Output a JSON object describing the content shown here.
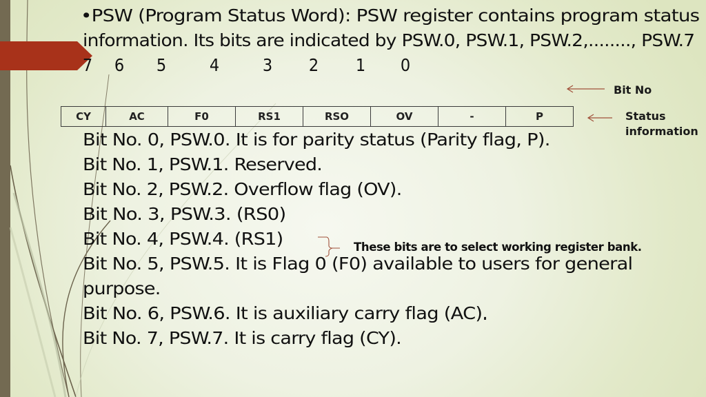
{
  "slide": {
    "heading_lines": [
      "•PSW (Program Status Word):  PSW register contains program status",
      "information.  Its bits are indicated by PSW.0, PSW.1, PSW.2,........, PSW.7"
    ],
    "bit_numbers": [
      "7",
      "6",
      "5",
      "4",
      "3",
      "2",
      "1",
      "0"
    ],
    "register_table": {
      "cells": [
        "CY",
        "AC",
        "F0",
        "RS1",
        "RSO",
        "OV",
        "-",
        "P"
      ]
    },
    "labels": {
      "bit_no": "Bit No",
      "status_information_line1": "Status",
      "status_information_line2": "information"
    },
    "bit_descriptions": [
      "Bit No. 0, PSW.0.  It is for parity status (Parity flag, P).",
      "Bit No. 1, PSW.1.   Reserved.",
      "Bit No. 2, PSW.2.  Overflow flag (OV).",
      "Bit No. 3, PSW.3.  (RS0)",
      "Bit No. 4, PSW.4.  (RS1)",
      "Bit No. 5, PSW.5.  It is Flag 0 (F0) available to users for general",
      "purpose.",
      "Bit No. 6, PSW.6.  It is auxiliary carry flag (AC).",
      "Bit No. 7, PSW.7.  It is carry flag (CY)."
    ],
    "register_bank_note": "These bits are to select working register bank.",
    "colors": {
      "accent_red": "#a8321a",
      "side_bar": "#736a52",
      "arrow_color": "#a0503a"
    }
  }
}
